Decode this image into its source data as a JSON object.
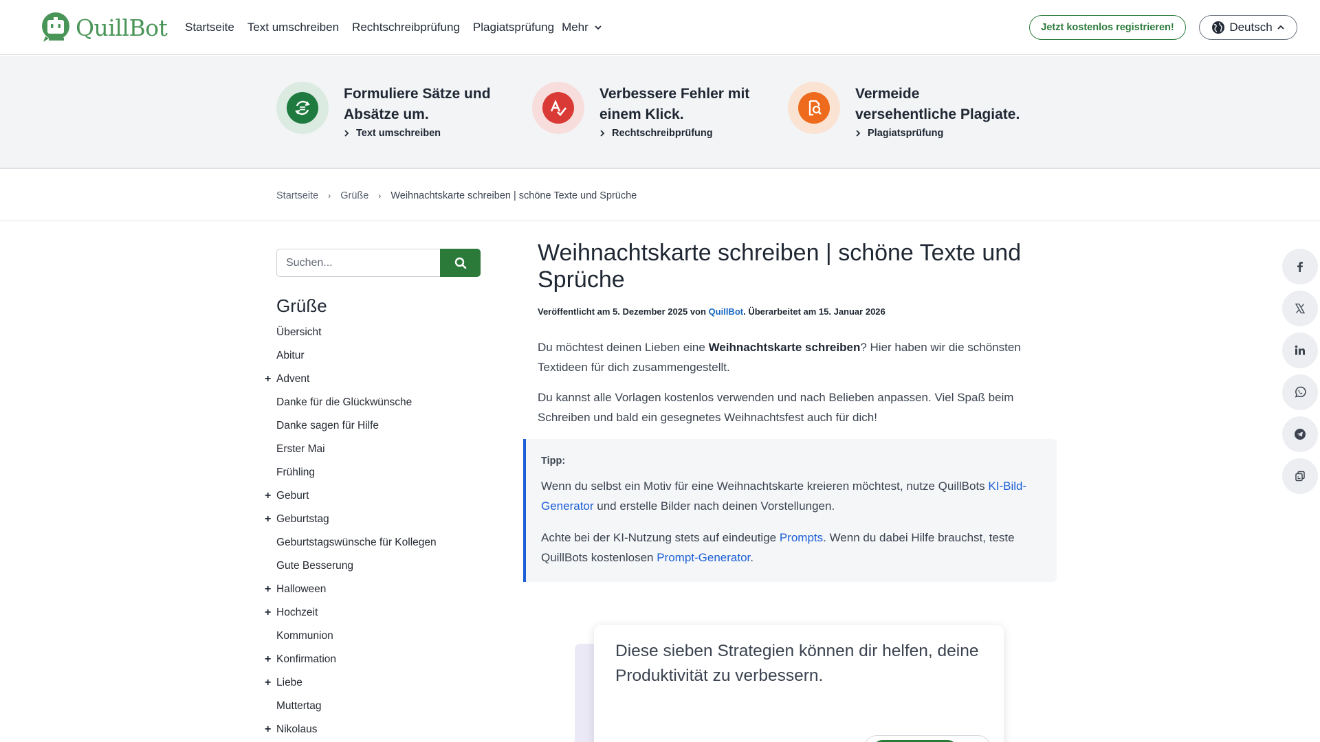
{
  "brand": {
    "name": "QuillBot",
    "color": "#499557",
    "accent": "#2b7a3a"
  },
  "nav": {
    "items": [
      "Startseite",
      "Text umschreiben",
      "Rechtschreibprüfung",
      "Plagiatsprüfung"
    ],
    "more_label": "Mehr",
    "register_label": "Jetzt kostenlos registrieren!",
    "language_label": "Deutsch"
  },
  "promo": [
    {
      "title": "Formuliere Sätze und Absätze um.",
      "link": "Text umschreiben",
      "icon": "rephrase-icon",
      "color": "#1e7a3e",
      "bg": "#dcebe1"
    },
    {
      "title": "Verbessere Fehler mit einem Klick.",
      "link": "Rechtschreibprüfung",
      "icon": "grammar-check-icon",
      "color": "#d93a35",
      "bg": "#f7dedd"
    },
    {
      "title": "Vermeide versehentliche Plagiate.",
      "link": "Plagiatsprüfung",
      "icon": "plagiarism-icon",
      "color": "#ee6a1c",
      "bg": "#fbe3d3"
    }
  ],
  "breadcrumb": [
    "Startseite",
    "Grüße",
    "Weihnachtskarte schreiben | schöne Texte und Sprüche"
  ],
  "search": {
    "placeholder": "Suchen..."
  },
  "sidebar": {
    "heading": "Grüße",
    "items": [
      {
        "label": "Übersicht",
        "expandable": false
      },
      {
        "label": "Abitur",
        "expandable": false
      },
      {
        "label": "Advent",
        "expandable": true
      },
      {
        "label": "Danke für die Glückwünsche",
        "expandable": false
      },
      {
        "label": "Danke sagen für Hilfe",
        "expandable": false
      },
      {
        "label": "Erster Mai",
        "expandable": false
      },
      {
        "label": "Frühling",
        "expandable": false
      },
      {
        "label": "Geburt",
        "expandable": true
      },
      {
        "label": "Geburtstag",
        "expandable": true
      },
      {
        "label": "Geburtstagswünsche für Kollegen",
        "expandable": false
      },
      {
        "label": "Gute Besserung",
        "expandable": false
      },
      {
        "label": "Halloween",
        "expandable": true
      },
      {
        "label": "Hochzeit",
        "expandable": true
      },
      {
        "label": "Kommunion",
        "expandable": false
      },
      {
        "label": "Konfirmation",
        "expandable": true
      },
      {
        "label": "Liebe",
        "expandable": true
      },
      {
        "label": "Muttertag",
        "expandable": false
      },
      {
        "label": "Nikolaus",
        "expandable": true
      }
    ]
  },
  "article": {
    "title": "Weihnachtskarte schreiben | schöne Texte und Sprüche",
    "byline": {
      "prefix": "Veröffentlicht am 5. Dezember 2025 von ",
      "author": "QuillBot",
      "suffix": ". Überarbeitet am 15. Januar 2026"
    },
    "intro1": {
      "before": "Du möchtest deinen Lieben eine ",
      "bold": "Weihnachtskarte schreiben",
      "after": "? Hier haben wir die schönsten Textideen für dich zusammengestellt."
    },
    "intro2": "Du kannst alle Vorlagen kostenlos verwenden und nach Belieben anpassen. Viel Spaß beim Schreiben und bald ein gesegnetes Weihnachtsfest auch für dich!",
    "tip": {
      "label": "Tipp:",
      "p1_before": "Wenn du selbst ein Motiv für eine Weihnachtskarte kreieren möchtest, nutze QuillBots ",
      "p1_link": "KI-Bild-Generator",
      "p1_after": " und erstelle Bilder nach deinen Vorstellungen.",
      "p2_before": "Achte bei der KI-Nutzung stets auf eindeutige ",
      "p2_link1": "Prompts",
      "p2_mid": ". Wenn du dabei Hilfe brauchst, teste QuillBots kostenlosen ",
      "p2_link2": "Prompt-Generator",
      "p2_after": "."
    },
    "card_text": "Diese sieben Strategien können dir helfen, deine Produktivität zu verbessern."
  },
  "share": [
    "facebook-icon",
    "x-icon",
    "linkedin-icon",
    "whatsapp-icon",
    "telegram-icon",
    "copy-icon"
  ]
}
